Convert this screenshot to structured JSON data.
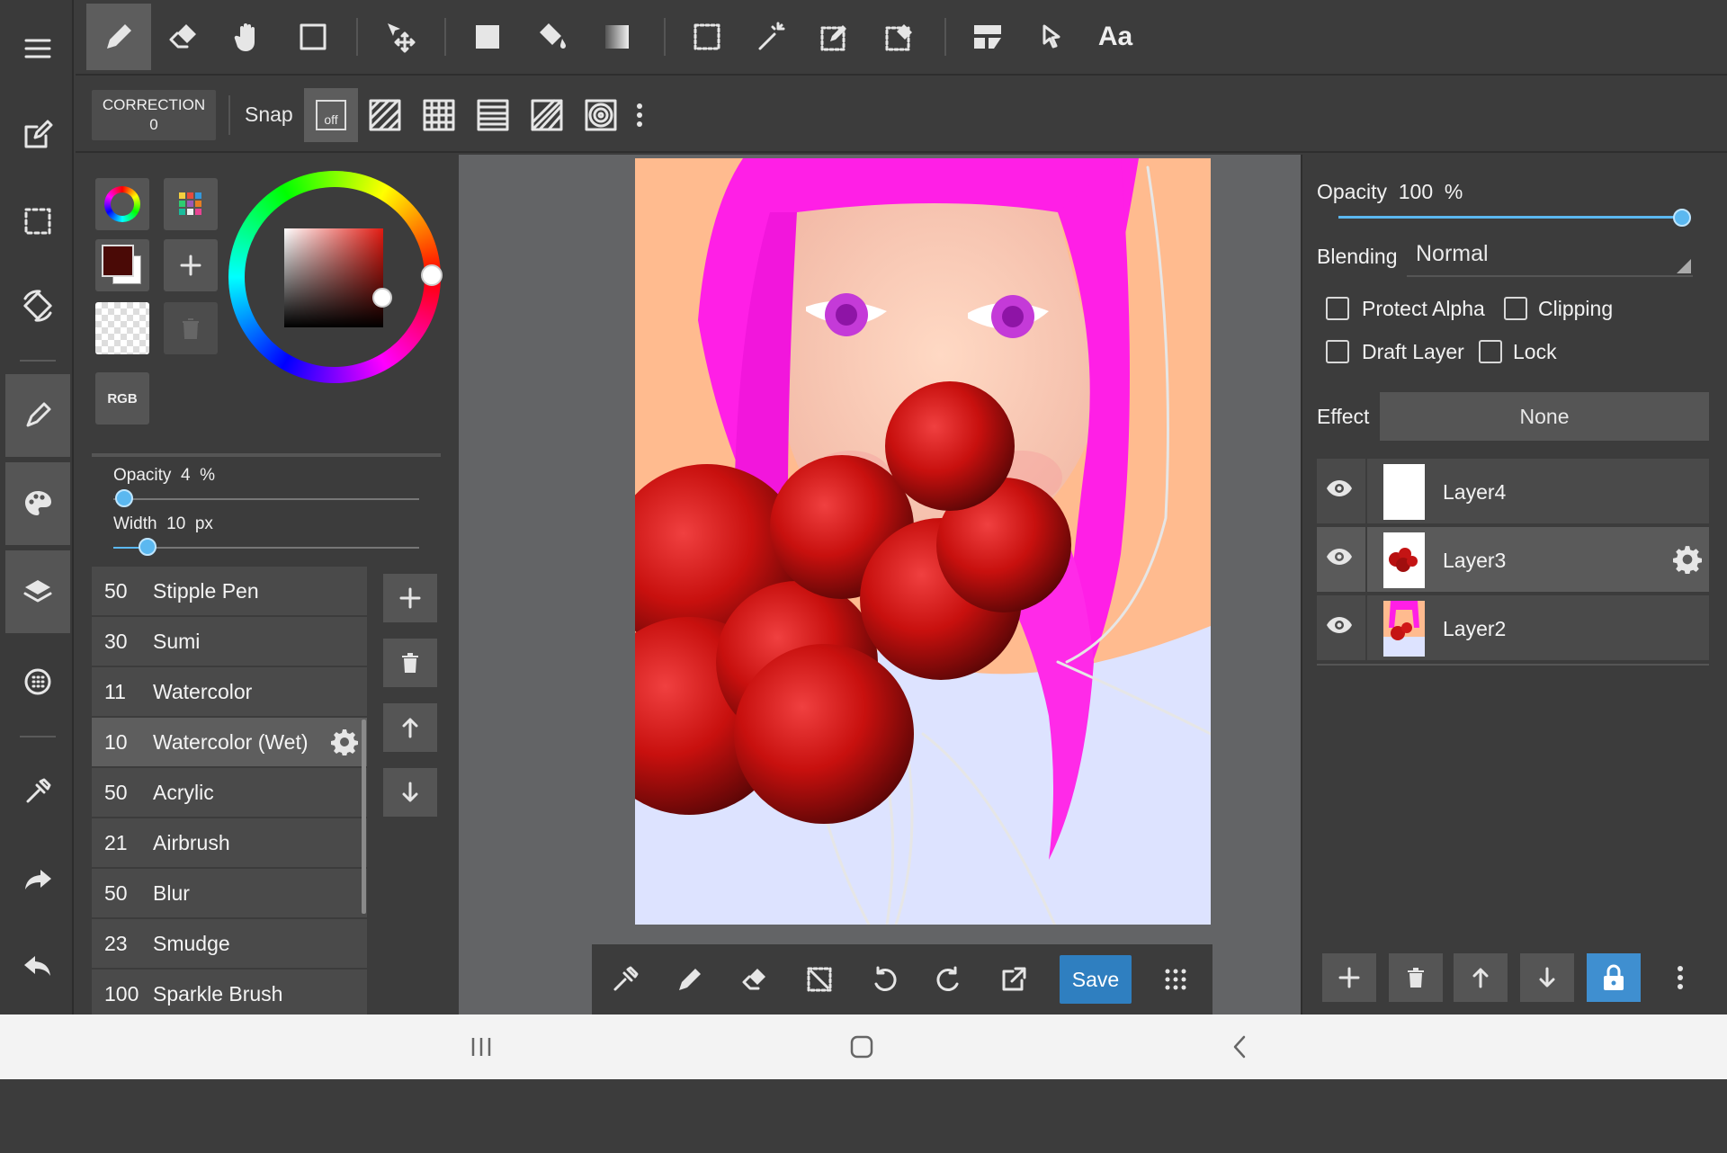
{
  "toolbar": {
    "font_button": "Aa"
  },
  "subbar": {
    "correction_label": "CORRECTION",
    "correction_value": "0",
    "snap_label": "Snap",
    "snap_off": "off"
  },
  "color_panel": {
    "mode_button": "RGB",
    "current_color": "#4a0a06",
    "ring_knob_color": "#ffffff"
  },
  "brush_settings": {
    "opacity_label": "Opacity",
    "opacity_value": "4",
    "opacity_unit": "%",
    "opacity_fraction": 0.04,
    "width_label": "Width",
    "width_value": "10",
    "width_unit": "px"
  },
  "brushes": [
    {
      "size": "50",
      "name": "Stipple Pen"
    },
    {
      "size": "30",
      "name": "Sumi"
    },
    {
      "size": "11",
      "name": "Watercolor"
    },
    {
      "size": "10",
      "name": "Watercolor (Wet)"
    },
    {
      "size": "50",
      "name": "Acrylic"
    },
    {
      "size": "21",
      "name": "Airbrush"
    },
    {
      "size": "50",
      "name": "Blur"
    },
    {
      "size": "23",
      "name": "Smudge"
    },
    {
      "size": "100",
      "name": "Sparkle Brush"
    }
  ],
  "selected_brush": "Watercolor (Wet)",
  "bottom_bar": {
    "save_label": "Save"
  },
  "layer_props": {
    "opacity_label": "Opacity",
    "opacity_value": "100",
    "opacity_unit": "%",
    "opacity_fraction": 1.0,
    "blending_label": "Blending",
    "blending_value": "Normal",
    "protect_alpha": "Protect Alpha",
    "clipping": "Clipping",
    "draft_layer": "Draft Layer",
    "lock": "Lock",
    "effect_label": "Effect",
    "effect_value": "None"
  },
  "layers": [
    {
      "name": "Layer4",
      "visible": true
    },
    {
      "name": "Layer3",
      "visible": true,
      "selected": true
    },
    {
      "name": "Layer2",
      "visible": true
    }
  ],
  "colors": {
    "accent": "#2f7fc0",
    "panel": "#3c3c3c",
    "canvas_bg": "#636466"
  }
}
